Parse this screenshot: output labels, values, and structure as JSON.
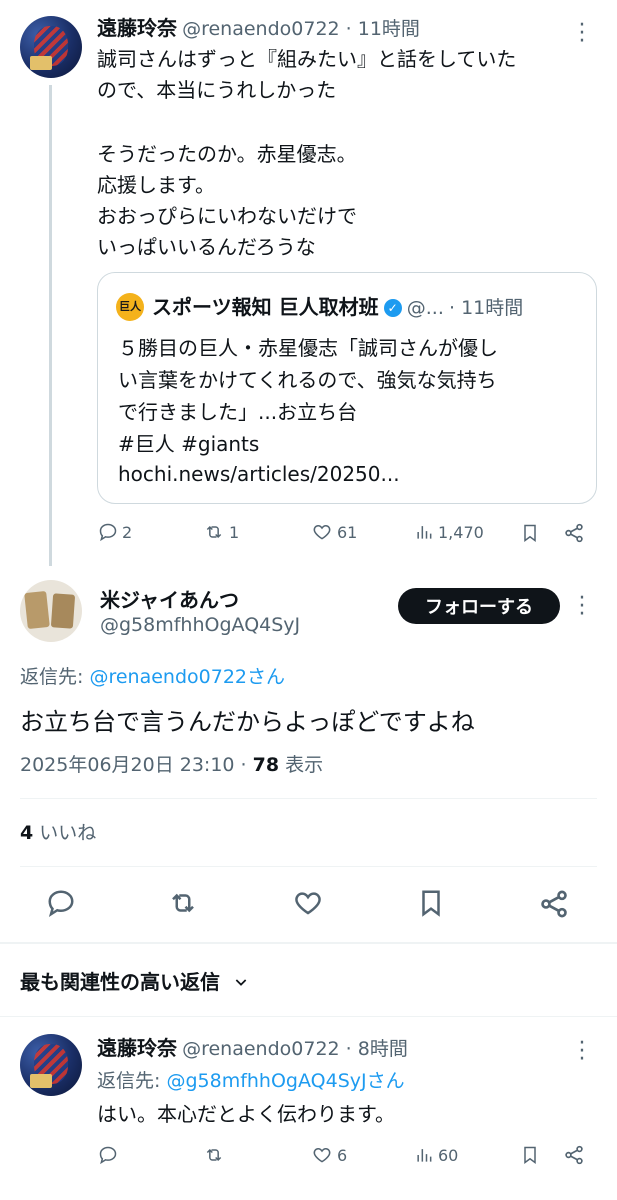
{
  "tweet1": {
    "name": "遠藤玲奈",
    "meta": "@renaendo0722 · 11時間",
    "lines": [
      "誠司さんはずっと『組みたい』と話をしていた",
      "ので、本当にうれしかった",
      "そうだったのか。赤星優志。",
      "応援します。",
      "おおっぴらにいわないだけで",
      "いっぱいいるんだろうな"
    ],
    "quote": {
      "logo": "巨人",
      "name": "スポーツ報知 巨人取材班",
      "handle": "@...",
      "time": "· 11時間",
      "lines": [
        "５勝目の巨人・赤星優志「誠司さんが優し",
        "い言葉をかけてくれるので、強気な気持ち",
        "で行きました」...お立ち台",
        "#巨人 #giants",
        "hochi.news/articles/20250..."
      ]
    },
    "actions": {
      "reply": "2",
      "retweet": "1",
      "like": "61",
      "views": "1,470"
    }
  },
  "main": {
    "name": "米ジャイあんつ",
    "handle": "@g58mfhhOgAQ4SyJ",
    "follow_label": "フォローする",
    "reply_to_prefix": "返信先: ",
    "reply_to_handle": "@renaendo0722さん",
    "text": "お立ち台で言うんだからよっぽどですよね",
    "date": "2025年06月20日 23:10 · ",
    "views_count": "78",
    "views_label": " 表示",
    "likes_count": "4",
    "likes_label": " いいね"
  },
  "sort_label": "最も関連性の高い返信",
  "reply": {
    "name": "遠藤玲奈",
    "meta": "@renaendo0722 · 8時間",
    "reply_to_prefix": "返信先: ",
    "reply_to_handle": "@g58mfhhOgAQ4SyJさん",
    "text": "はい。本心だとよく伝わります。",
    "actions": {
      "like": "6",
      "views": "60"
    }
  }
}
